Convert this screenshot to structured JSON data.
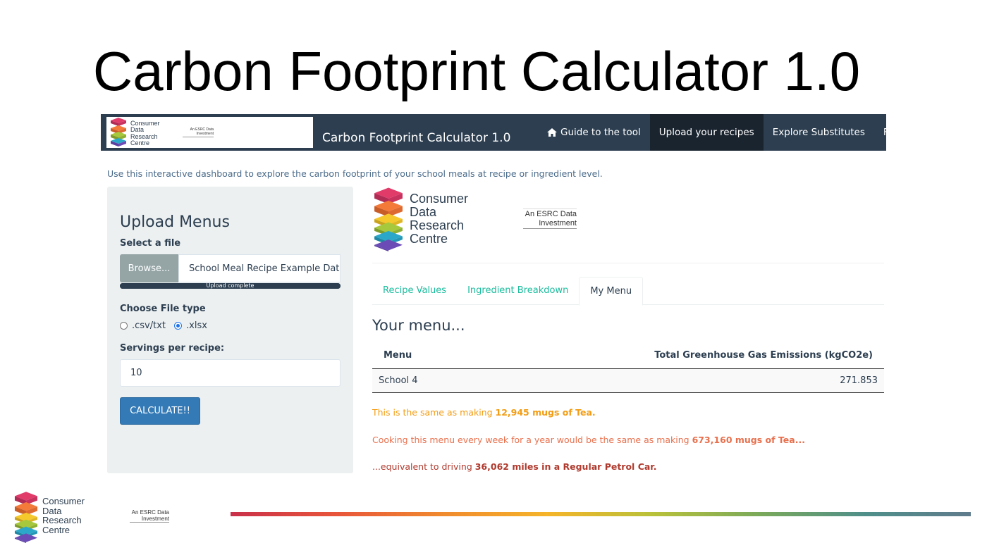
{
  "slide": {
    "title": "Carbon Footprint Calculator 1.0"
  },
  "logo": {
    "name_lines": [
      "Consumer",
      "Data",
      "Research",
      "Centre"
    ],
    "esrc_lines": [
      "An ESRC Data",
      "Investment"
    ]
  },
  "navbar": {
    "brand": "Carbon Footprint Calculator 1.0",
    "items": [
      {
        "label": "Guide to the tool",
        "icon": "home-icon"
      },
      {
        "label": "Upload your recipes"
      },
      {
        "label": "Explore Substitutes"
      },
      {
        "label": "Further Information"
      }
    ]
  },
  "intro": "Use this interactive dashboard to explore the carbon footprint of your school meals at recipe or ingredient level.",
  "sidebar": {
    "title": "Upload Menus",
    "file_label": "Select a file",
    "browse_label": "Browse...",
    "file_name": "School Meal Recipe Example Data.",
    "progress_text": "Upload complete",
    "progress_fraction": 1.0,
    "file_type_label": "Choose File type",
    "file_types": [
      {
        "label": ".csv/txt",
        "checked": false
      },
      {
        "label": ".xlsx",
        "checked": true
      }
    ],
    "servings_label": "Servings per recipe:",
    "servings_value": "10",
    "calculate_label": "CALCULATE!!"
  },
  "tabs": [
    {
      "label": "Recipe Values"
    },
    {
      "label": "Ingredient Breakdown"
    },
    {
      "label": "My Menu"
    }
  ],
  "menu": {
    "heading": "Your menu...",
    "columns": [
      "Menu",
      "Total Greenhouse Gas Emissions (kgCO2e)"
    ],
    "rows": [
      [
        "School 4",
        "271.853"
      ]
    ]
  },
  "results": {
    "line1_prefix": "This is the same as making ",
    "line1_value": "12,945 mugs of Tea.",
    "line2_prefix": "Cooking this menu every week for a year would be the same as making ",
    "line2_value": "673,160 mugs of Tea...",
    "line3_prefix": "...equivalent to driving ",
    "line3_value": "36,062 miles in a Regular Petrol Car."
  },
  "colors": {
    "navbar": "#2c3e50",
    "tab_link": "#18bc9c",
    "button": "#337ab7",
    "result1": "#f39c12",
    "result2": "#e8704d",
    "result3": "#b03a2e"
  }
}
